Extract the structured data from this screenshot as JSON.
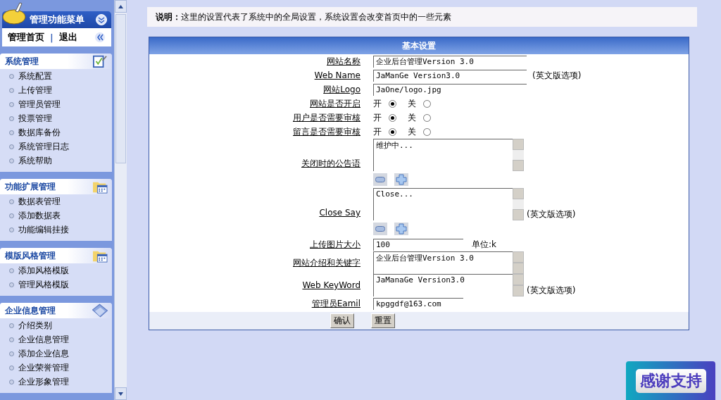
{
  "sidebar": {
    "title": "管理功能菜单",
    "links": [
      "管理首页",
      "|",
      "退出"
    ],
    "sections": [
      {
        "title": "系统管理",
        "items": [
          "系统配置",
          "上传管理",
          "管理员管理",
          "投票管理",
          "数据库备份",
          "系统管理日志",
          "系统帮助"
        ]
      },
      {
        "title": "功能扩展管理",
        "items": [
          "数据表管理",
          "添加数据表",
          "功能编辑挂接"
        ]
      },
      {
        "title": "模版风格管理",
        "items": [
          "添加风格模版",
          "管理风格模版"
        ]
      },
      {
        "title": "企业信息管理",
        "items": [
          "介绍类别",
          "企业信息管理",
          "添加企业信息",
          "企业荣誉管理",
          "企业形象管理"
        ]
      }
    ]
  },
  "notice": {
    "label": "说明：",
    "text": "这里的设置代表了系统中的全局设置，系统设置会改变首页中的一些元素"
  },
  "form": {
    "title": "基本设置",
    "rows": [
      {
        "kind": "text",
        "label": "网站名称",
        "value": "企业后台管理Version 3.0"
      },
      {
        "kind": "text",
        "label": "Web Name",
        "value": "JaManGe Version3.0",
        "note": "(英文版选项)"
      },
      {
        "kind": "text",
        "label": "网站Logo",
        "value": "JaOne/logo.jpg"
      },
      {
        "kind": "radio",
        "label": "网站是否开启",
        "options": [
          {
            "label": "开",
            "selected": true
          },
          {
            "label": "关",
            "selected": false
          }
        ]
      },
      {
        "kind": "radio",
        "label": "用户是否需要审核",
        "options": [
          {
            "label": "开",
            "selected": true
          },
          {
            "label": "关",
            "selected": false
          }
        ]
      },
      {
        "kind": "radio",
        "label": "留言是否需要审核",
        "options": [
          {
            "label": "开",
            "selected": true
          },
          {
            "label": "关",
            "selected": false
          }
        ]
      },
      {
        "kind": "bigtext",
        "label": "关闭时的公告语",
        "value": "维护中..."
      },
      {
        "kind": "bigtext",
        "label": "Close Say",
        "value": "Close...",
        "note": "(英文版选项)"
      },
      {
        "kind": "short",
        "label": "上传图片大小",
        "value": "100",
        "note": "单位:k"
      },
      {
        "kind": "area",
        "label": "网站介绍和关键字",
        "value": "企业后台管理Version 3.0"
      },
      {
        "kind": "area",
        "label": "Web KeyWord",
        "value": "JaManaGe Version3.0",
        "note": "(英文版选项)"
      },
      {
        "kind": "short",
        "label": "管理员Eamil",
        "value": "kpggdf@163.com"
      }
    ],
    "buttons": [
      "确认",
      "重置"
    ]
  },
  "badge": "感谢支持"
}
